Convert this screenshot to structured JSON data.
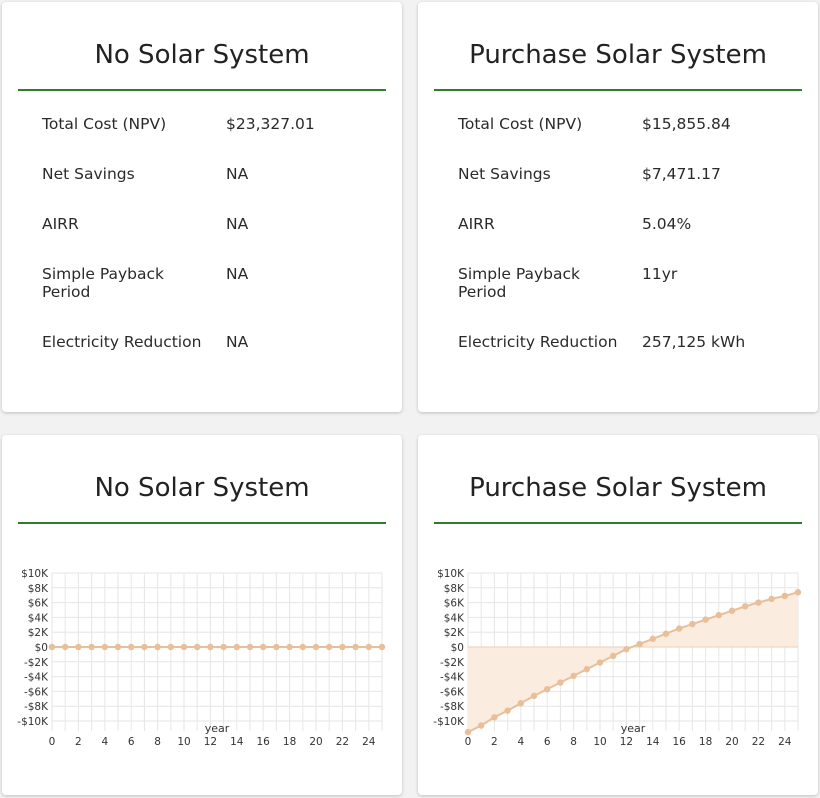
{
  "cards": {
    "no_solar": {
      "title": "No Solar System"
    },
    "purchase": {
      "title": "Purchase Solar System"
    }
  },
  "metrics": {
    "no_solar": [
      {
        "label": "Total Cost (NPV)",
        "value": "$23,327.01"
      },
      {
        "label": "Net Savings",
        "value": "NA"
      },
      {
        "label": "AIRR",
        "value": "NA"
      },
      {
        "label": "Simple Payback Period",
        "value": "NA"
      },
      {
        "label": "Electricity Reduction",
        "value": "NA"
      }
    ],
    "purchase": [
      {
        "label": "Total Cost (NPV)",
        "value": "$15,855.84"
      },
      {
        "label": "Net Savings",
        "value": "$7,471.17"
      },
      {
        "label": "AIRR",
        "value": "5.04%"
      },
      {
        "label": "Simple Payback Period",
        "value": "11yr"
      },
      {
        "label": "Electricity Reduction",
        "value": "257,125 kWh"
      }
    ]
  },
  "colors": {
    "accent_line": "#2e7d32",
    "series": "#e8bf98",
    "fill": "#fbece0",
    "grid": "#e6e6e6"
  },
  "chart_data": [
    {
      "type": "line",
      "title": "No Solar System",
      "xlabel": "year",
      "ylabel": "",
      "xlim": [
        0,
        25
      ],
      "ylim": [
        -10000,
        10000
      ],
      "x_ticks": [
        0,
        2,
        4,
        6,
        8,
        10,
        12,
        14,
        16,
        18,
        20,
        22,
        24
      ],
      "y_ticks": [
        "$10K",
        "$8K",
        "$6K",
        "$4K",
        "$2K",
        "$0",
        "-$2K",
        "-$4K",
        "-$6K",
        "-$8K",
        "-$10K"
      ],
      "grid": true,
      "series": [
        {
          "x": [
            0,
            1,
            2,
            3,
            4,
            5,
            6,
            7,
            8,
            9,
            10,
            11,
            12,
            13,
            14,
            15,
            16,
            17,
            18,
            19,
            20,
            21,
            22,
            23,
            24,
            25
          ],
          "values": [
            0,
            0,
            0,
            0,
            0,
            0,
            0,
            0,
            0,
            0,
            0,
            0,
            0,
            0,
            0,
            0,
            0,
            0,
            0,
            0,
            0,
            0,
            0,
            0,
            0,
            0
          ]
        }
      ]
    },
    {
      "type": "area",
      "title": "Purchase Solar System",
      "xlabel": "year",
      "ylabel": "",
      "xlim": [
        0,
        25
      ],
      "ylim": [
        -10000,
        10000
      ],
      "x_ticks": [
        0,
        2,
        4,
        6,
        8,
        10,
        12,
        14,
        16,
        18,
        20,
        22,
        24
      ],
      "y_ticks": [
        "$10K",
        "$8K",
        "$6K",
        "$4K",
        "$2K",
        "$0",
        "-$2K",
        "-$4K",
        "-$6K",
        "-$8K",
        "-$10K"
      ],
      "grid": true,
      "series": [
        {
          "x": [
            0,
            1,
            2,
            3,
            4,
            5,
            6,
            7,
            8,
            9,
            10,
            11,
            12,
            13,
            14,
            15,
            16,
            17,
            18,
            19,
            20,
            21,
            22,
            23,
            24,
            25
          ],
          "values": [
            -11500,
            -10600,
            -9500,
            -8600,
            -7600,
            -6600,
            -5700,
            -4800,
            -3900,
            -3000,
            -2100,
            -1200,
            -300,
            400,
            1100,
            1800,
            2500,
            3100,
            3700,
            4300,
            4900,
            5500,
            6000,
            6500,
            6900,
            7400
          ]
        }
      ]
    }
  ]
}
